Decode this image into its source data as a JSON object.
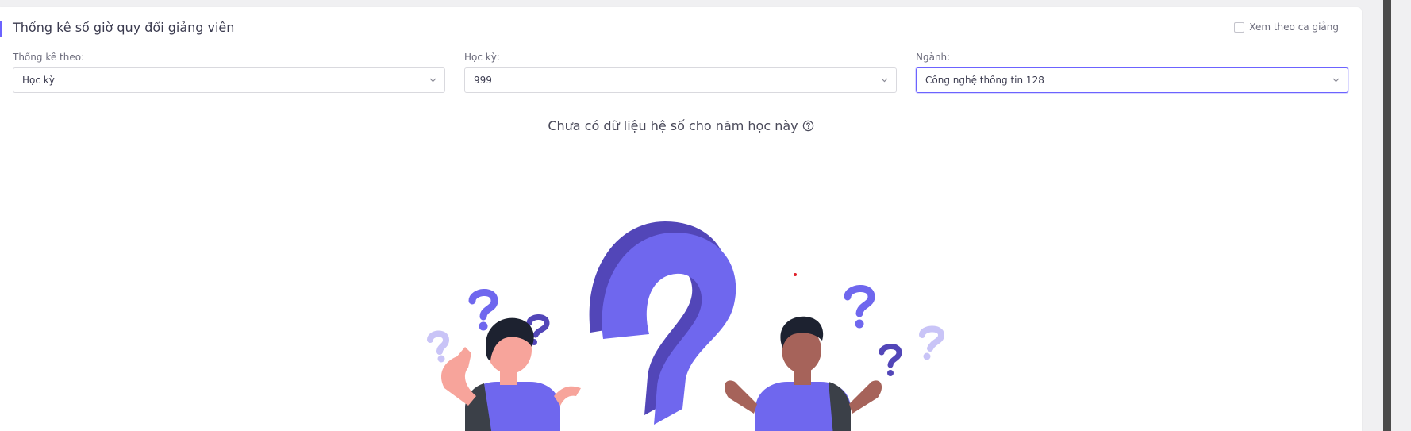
{
  "header": {
    "title": "Thống kê số giờ quy đổi giảng viên"
  },
  "view_by_shift": {
    "label": "Xem theo ca giảng",
    "checked": false
  },
  "filters": {
    "stat_by": {
      "label": "Thống kê theo:",
      "value": "Học kỳ"
    },
    "semester": {
      "label": "Học kỳ:",
      "value": "999"
    },
    "major": {
      "label": "Ngành:",
      "value": "Công nghệ thông tin 128"
    }
  },
  "empty_state": {
    "message": "Chưa có dữ liệu hệ số cho năm học này"
  },
  "colors": {
    "accent": "#6c63ff",
    "illustration_purple": "#6f67ee",
    "illustration_dark": "#5246b8",
    "illustration_light": "#c9c4f7"
  }
}
